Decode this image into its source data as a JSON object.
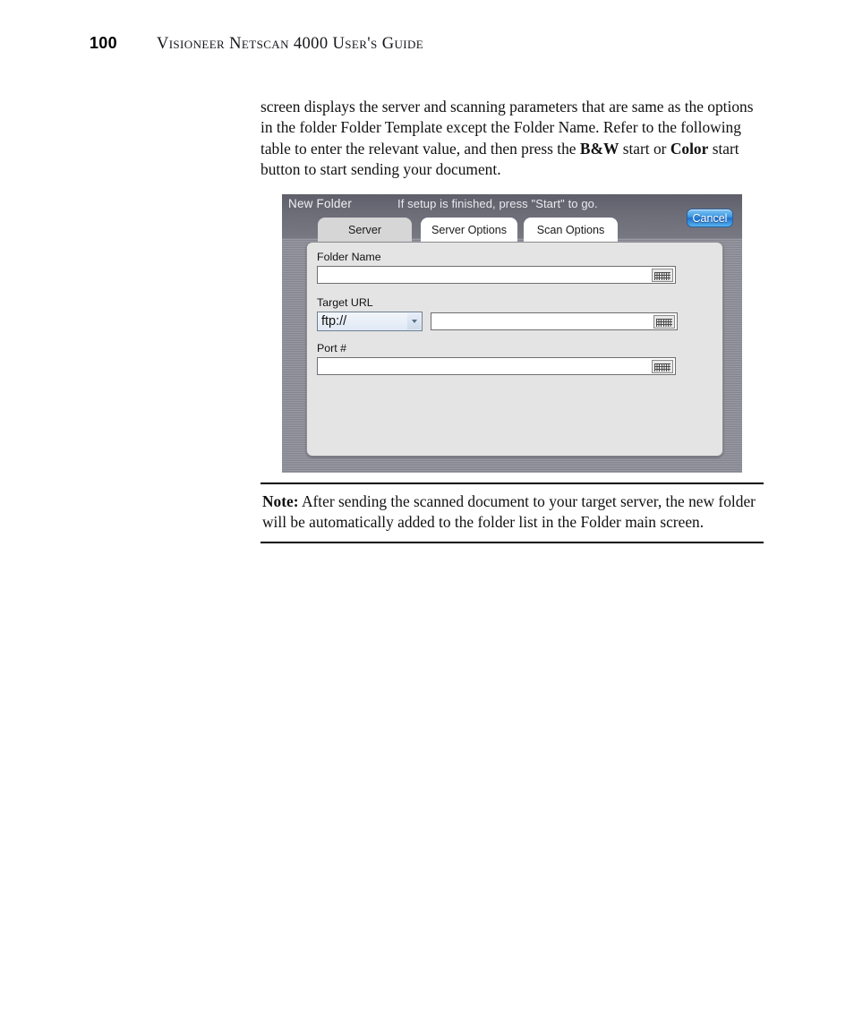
{
  "page": {
    "folio": "100",
    "running_head": "Visioneer Netscan 4000 User's Guide"
  },
  "body": {
    "paragraph_part1": "screen displays the server and scanning parameters that are same as the options in the folder Folder Template except the Folder Name. Refer to the following table to enter the relevant value, and then press the ",
    "bold_bw": "B&W",
    "paragraph_part2": " start or ",
    "bold_color": "Color",
    "paragraph_part3": " start button to start sending your document."
  },
  "device_screen": {
    "title": "New Folder",
    "hint": "If setup is finished, press \"Start\" to go.",
    "cancel_label": "Cancel",
    "tabs": [
      {
        "label": "Server",
        "active": true
      },
      {
        "label": "Server Options",
        "active": false
      },
      {
        "label": "Scan Options",
        "active": false
      }
    ],
    "fields": [
      {
        "label": "Folder Name",
        "value": "",
        "keyboard_icon": "keyboard-icon"
      },
      {
        "label": "Target URL",
        "protocol_selected": "ftp://",
        "value": "",
        "keyboard_icon": "keyboard-icon"
      },
      {
        "label": "Port #",
        "value": "",
        "keyboard_icon": "keyboard-icon"
      }
    ],
    "colors": {
      "titlebar": "#6d6d78",
      "panel": "#e4e4e4",
      "active_tab": "#d6d6d6",
      "inactive_tab": "#ffffff",
      "cancel_button": "#3e9ae4",
      "bezel": "#9a9aa4"
    }
  },
  "note": {
    "label": "Note:",
    "text": " After sending the scanned document to your target server, the new folder will be automatically added to the folder list in the Folder main screen."
  }
}
